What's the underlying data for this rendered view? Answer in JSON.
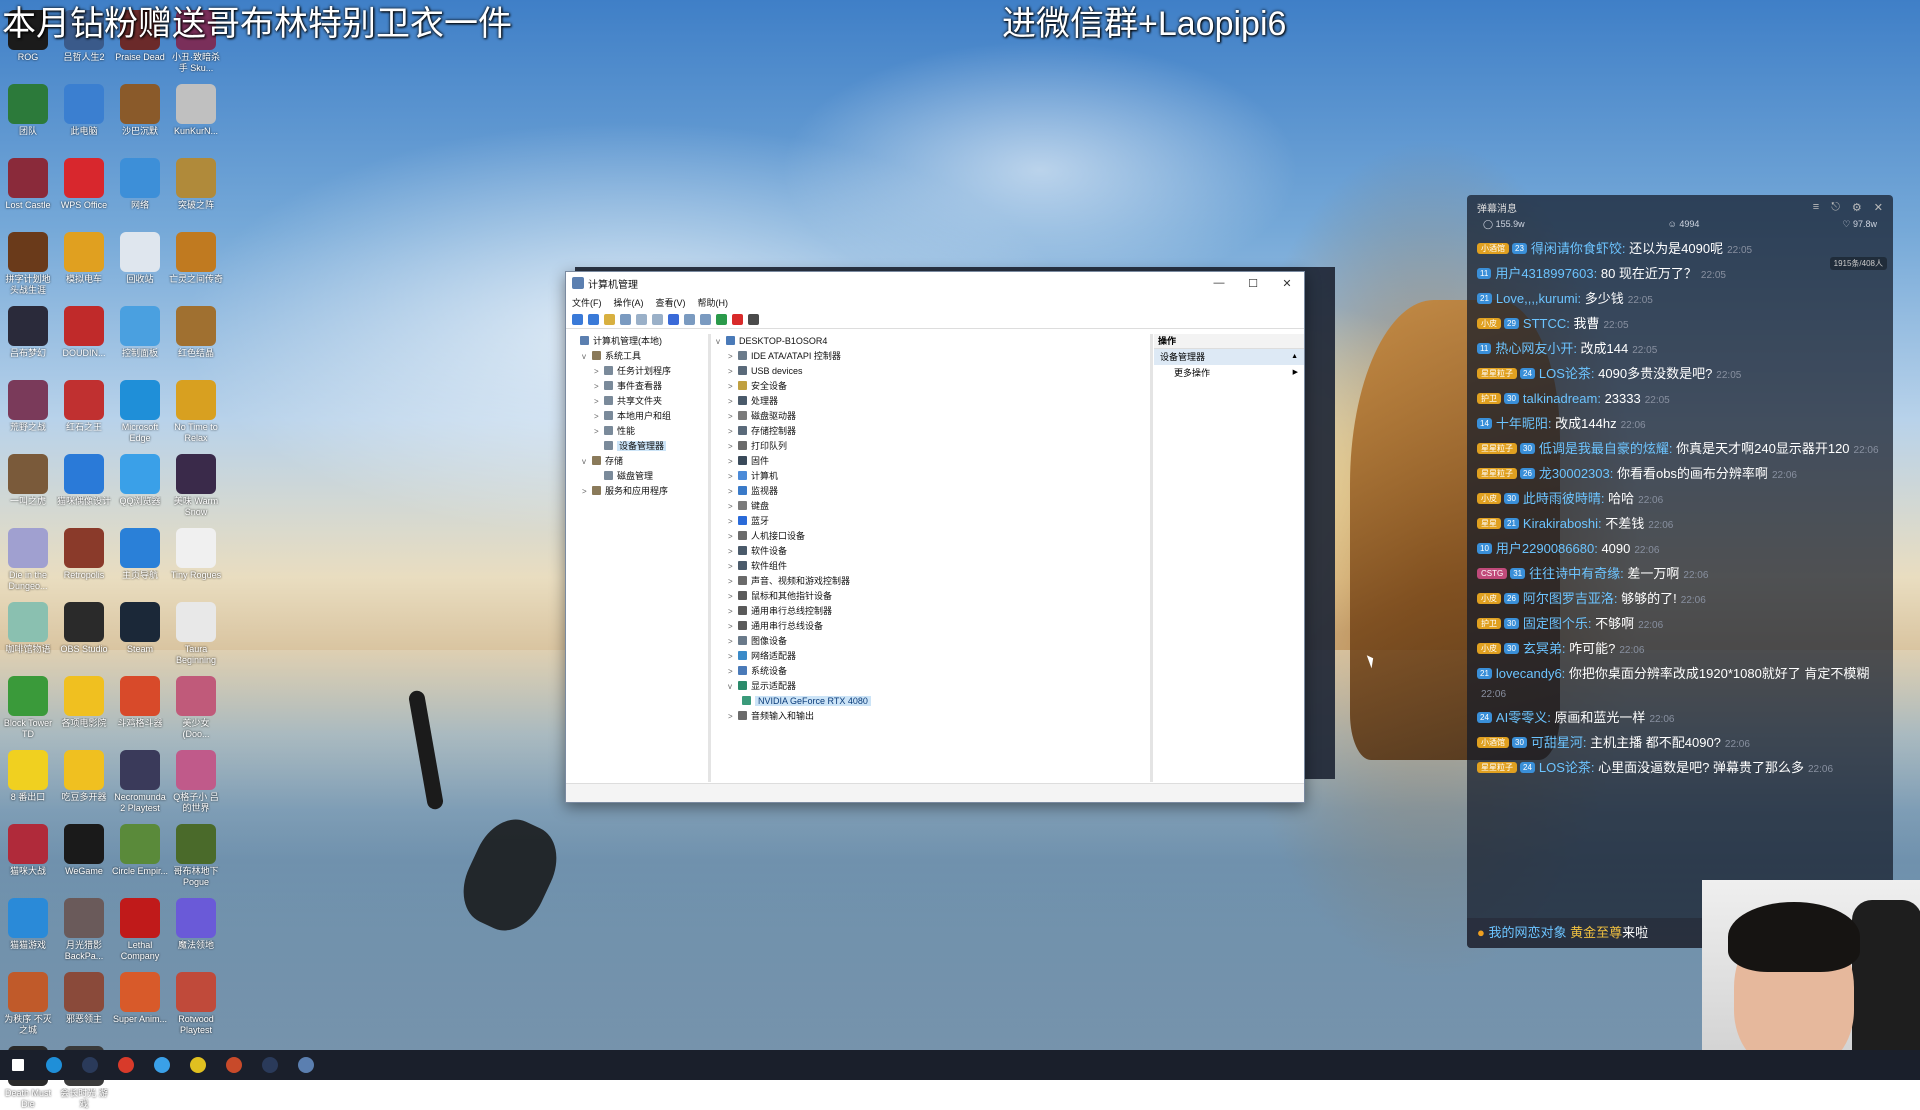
{
  "overlay": {
    "left_text": "本月钻粉赠送哥布林特别卫衣一件",
    "right_text": "进微信群+Laopipi6"
  },
  "desktop_icons": [
    {
      "label": "ROG",
      "color": "#1b1b1b"
    },
    {
      "label": "吕哲人生2",
      "color": "#3a5a8a"
    },
    {
      "label": "Praise Dead",
      "color": "#6b2a2a"
    },
    {
      "label": "小丑·致暗杀手 Sku...",
      "color": "#7a2f5a"
    },
    {
      "label": "团队",
      "color": "#2c7a3a"
    },
    {
      "label": "此电脑",
      "color": "#3b7fd0"
    },
    {
      "label": "沙巴沉默",
      "color": "#8a5a2a"
    },
    {
      "label": "KunKurN...",
      "color": "#c0c0c0"
    },
    {
      "label": "Lost Castle",
      "color": "#8a2a3a"
    },
    {
      "label": "WPS Office",
      "color": "#d8272d"
    },
    {
      "label": "网络",
      "color": "#3d8fd8"
    },
    {
      "label": "突破之阵",
      "color": "#b08a3a"
    },
    {
      "label": "拼字计划地 头战生涯",
      "color": "#6a3a1a"
    },
    {
      "label": "模拟电车",
      "color": "#e0a020"
    },
    {
      "label": "回收站",
      "color": "#dfe6ee"
    },
    {
      "label": "亡灵之间传奇",
      "color": "#c07a20"
    },
    {
      "label": "吕布梦幻",
      "color": "#2a2a3a"
    },
    {
      "label": "DOUDIN...",
      "color": "#c02a2a"
    },
    {
      "label": "控制面板",
      "color": "#4aa0e0"
    },
    {
      "label": "红色结晶",
      "color": "#a07030"
    },
    {
      "label": "荒野之战",
      "color": "#7a3a5a"
    },
    {
      "label": "红石之王",
      "color": "#c03030"
    },
    {
      "label": "Microsoft Edge",
      "color": "#1f8fd8"
    },
    {
      "label": "No Time to Relax",
      "color": "#d8a020"
    },
    {
      "label": "一叫之虎",
      "color": "#7a5a3a"
    },
    {
      "label": "猫咪偶像设计",
      "color": "#2a7ad8"
    },
    {
      "label": "QQ浏览器",
      "color": "#3aa0e8"
    },
    {
      "label": "美味 Warm Snow",
      "color": "#3a2a4a"
    },
    {
      "label": "Die in the Dungeo...",
      "color": "#a0a0d0"
    },
    {
      "label": "Retropolis",
      "color": "#8a3a2a"
    },
    {
      "label": "主页导航",
      "color": "#2a80d8"
    },
    {
      "label": "Tiny Rogues",
      "color": "#f0f0f0"
    },
    {
      "label": "咖啡馆物语",
      "color": "#8ac0b0"
    },
    {
      "label": "OBS Studio",
      "color": "#2a2a2a"
    },
    {
      "label": "Steam",
      "color": "#1b2838"
    },
    {
      "label": "Taura Beginning",
      "color": "#e8e8e8"
    },
    {
      "label": "Block Tower TD",
      "color": "#3a9a3a"
    },
    {
      "label": "各项电影院",
      "color": "#f0c020"
    },
    {
      "label": "斗鸡格斗器",
      "color": "#d84a2a"
    },
    {
      "label": "美少女 (Doo...",
      "color": "#c05a7a"
    },
    {
      "label": "8 番出口",
      "color": "#f0d020"
    },
    {
      "label": "吃豆多开器",
      "color": "#f0c020"
    },
    {
      "label": "Necromunda 2 Playtest",
      "color": "#3a3a5a"
    },
    {
      "label": "Q格子小 吕 的世界",
      "color": "#c05a8a"
    },
    {
      "label": "猫咪大战",
      "color": "#b02a3a"
    },
    {
      "label": "WeGame",
      "color": "#1a1a1a"
    },
    {
      "label": "Circle Empir...",
      "color": "#5a8a3a"
    },
    {
      "label": "哥布林地下 Pogue",
      "color": "#4a6a2a"
    },
    {
      "label": "猫猫游戏",
      "color": "#2a8ad8"
    },
    {
      "label": "月光猎影 BackPa...",
      "color": "#6a5a5a"
    },
    {
      "label": "Lethal Company",
      "color": "#c01a1a"
    },
    {
      "label": "魔法领地",
      "color": "#6a5ad8"
    },
    {
      "label": "为秩序 不灭之城",
      "color": "#c05a2a"
    },
    {
      "label": "邪恶领主",
      "color": "#8a4a3a"
    },
    {
      "label": "Super Anim...",
      "color": "#d85a2a"
    },
    {
      "label": "Rotwood Playtest",
      "color": "#c04a3a"
    },
    {
      "label": "Death Must Die",
      "color": "#2a2a2a"
    },
    {
      "label": "会长时光 游戏",
      "color": "#3a3a3a"
    }
  ],
  "window": {
    "title": "计算机管理",
    "menus": [
      "文件(F)",
      "操作(A)",
      "查看(V)",
      "帮助(H)"
    ],
    "left_tree": [
      {
        "label": "计算机管理(本地)",
        "level": 0,
        "arrow": ""
      },
      {
        "label": "系统工具",
        "level": 1,
        "arrow": "v"
      },
      {
        "label": "任务计划程序",
        "level": 2,
        "arrow": ">"
      },
      {
        "label": "事件查看器",
        "level": 2,
        "arrow": ">"
      },
      {
        "label": "共享文件夹",
        "level": 2,
        "arrow": ">"
      },
      {
        "label": "本地用户和组",
        "level": 2,
        "arrow": ">"
      },
      {
        "label": "性能",
        "level": 2,
        "arrow": ">"
      },
      {
        "label": "设备管理器",
        "level": 2,
        "arrow": "",
        "selected": true
      },
      {
        "label": "存储",
        "level": 1,
        "arrow": "v"
      },
      {
        "label": "磁盘管理",
        "level": 2,
        "arrow": ""
      },
      {
        "label": "服务和应用程序",
        "level": 1,
        "arrow": ">"
      }
    ],
    "device_root": "DESKTOP-B1OSOR4",
    "devices": [
      {
        "label": "IDE ATA/ATAPI 控制器",
        "color": "#6a7a8a"
      },
      {
        "label": "USB devices",
        "color": "#5a6a7a"
      },
      {
        "label": "安全设备",
        "color": "#c0a040"
      },
      {
        "label": "处理器",
        "color": "#4a5a6a"
      },
      {
        "label": "磁盘驱动器",
        "color": "#7a7a7a"
      },
      {
        "label": "存储控制器",
        "color": "#5a6a7a"
      },
      {
        "label": "打印队列",
        "color": "#6a6a6a"
      },
      {
        "label": "固件",
        "color": "#3a4a5a"
      },
      {
        "label": "计算机",
        "color": "#4a8ad8"
      },
      {
        "label": "监视器",
        "color": "#3a7ac8"
      },
      {
        "label": "键盘",
        "color": "#7a7a7a"
      },
      {
        "label": "蓝牙",
        "color": "#2a6ad8"
      },
      {
        "label": "人机接口设备",
        "color": "#6a6a6a"
      },
      {
        "label": "软件设备",
        "color": "#4a5a6a"
      },
      {
        "label": "软件组件",
        "color": "#4a5a6a"
      },
      {
        "label": "声音、视频和游戏控制器",
        "color": "#6a6a6a"
      },
      {
        "label": "鼠标和其他指针设备",
        "color": "#5a5a5a"
      },
      {
        "label": "通用串行总线控制器",
        "color": "#5a5a5a"
      },
      {
        "label": "通用串行总线设备",
        "color": "#5a5a5a"
      },
      {
        "label": "图像设备",
        "color": "#6a7a8a"
      },
      {
        "label": "网络适配器",
        "color": "#3a8ac8"
      },
      {
        "label": "系统设备",
        "color": "#4a7ab8"
      },
      {
        "label": "显示适配器",
        "color": "#2a8a6a",
        "expanded": true
      },
      {
        "label": "NVIDIA GeForce RTX 4080",
        "color": "#3a9a7a",
        "child": true
      },
      {
        "label": "音频输入和输出",
        "color": "#6a6a6a"
      }
    ],
    "actions_header": "操作",
    "actions": [
      {
        "label": "设备管理器",
        "selected": true,
        "arrow": "▲"
      },
      {
        "label": "更多操作",
        "selected": false,
        "arrow": "▶"
      }
    ]
  },
  "chat": {
    "title": "弹幕消息",
    "stats": {
      "hot": "155.9w",
      "online": "4994",
      "likes": "97.8w"
    },
    "rank_badge": "1915条/408人",
    "messages": [
      {
        "badge": "小酒馆",
        "badge_color": "#e0a020",
        "lvl": "23",
        "user": "得闲请你食虾饺:",
        "text": "还以为是4090呢",
        "time": "22:05"
      },
      {
        "badge": "",
        "badge_color": "",
        "lvl": "11",
        "user": "用户4318997603:",
        "text": "80 现在近万了？",
        "time": "22:05"
      },
      {
        "badge": "",
        "badge_color": "",
        "lvl": "21",
        "user": "Love,,,,kurumi:",
        "text": "多少钱",
        "time": "22:05"
      },
      {
        "badge": "小皮",
        "badge_color": "#e0a020",
        "lvl": "29",
        "user": "STTCC:",
        "text": "我曹",
        "time": "22:05"
      },
      {
        "badge": "",
        "badge_color": "",
        "lvl": "11",
        "user": "热心网友小开:",
        "text": "改成144",
        "time": "22:05"
      },
      {
        "badge": "星星粒子",
        "badge_color": "#e0a020",
        "lvl": "24",
        "user": "LOS论茶:",
        "text": "4090多贵没数是吧?",
        "time": "22:05"
      },
      {
        "badge": "护卫",
        "badge_color": "#e0a020",
        "lvl": "30",
        "user": "talkinadream:",
        "text": "23333",
        "time": "22:05"
      },
      {
        "badge": "",
        "badge_color": "",
        "lvl": "14",
        "user": "十年昵阳:",
        "text": "改成144hz",
        "time": "22:06"
      },
      {
        "badge": "星星粒子",
        "badge_color": "#e0a020",
        "lvl": "30",
        "user": "低调是我最自豪的炫耀:",
        "text": "你真是天才啊240显示器开120",
        "time": "22:06"
      },
      {
        "badge": "星星粒子",
        "badge_color": "#e0a020",
        "lvl": "26",
        "user": "龙30002303:",
        "text": "你看看obs的画布分辨率啊",
        "time": "22:06"
      },
      {
        "badge": "小皮",
        "badge_color": "#e0a020",
        "lvl": "30",
        "user": "此時雨彼時晴:",
        "text": "哈哈",
        "time": "22:06"
      },
      {
        "badge": "星星",
        "badge_color": "#e0a020",
        "lvl": "21",
        "user": "Kirakiraboshi:",
        "text": "不差钱",
        "time": "22:06"
      },
      {
        "badge": "",
        "badge_color": "",
        "lvl": "10",
        "user": "用户2290086680:",
        "text": "4090",
        "time": "22:06"
      },
      {
        "badge": "CSTG",
        "badge_color": "#c04a7a",
        "lvl": "31",
        "user": "往往诗中有奇缘:",
        "text": "差一万啊",
        "time": "22:06"
      },
      {
        "badge": "小皮",
        "badge_color": "#e0a020",
        "lvl": "26",
        "user": "阿尔图罗吉亚洛:",
        "text": "够够的了!",
        "time": "22:06"
      },
      {
        "badge": "护卫",
        "badge_color": "#e0a020",
        "lvl": "30",
        "user": "固定图个乐:",
        "text": "不够啊",
        "time": "22:06"
      },
      {
        "badge": "小皮",
        "badge_color": "#e0a020",
        "lvl": "30",
        "user": "玄冥弟:",
        "text": "咋可能?",
        "time": "22:06"
      },
      {
        "badge": "",
        "badge_color": "",
        "lvl": "21",
        "user": "lovecandy6:",
        "text": "你把你桌面分辨率改成1920*1080就好了 肯定不模糊",
        "time": "22:06"
      },
      {
        "badge": "",
        "badge_color": "",
        "lvl": "24",
        "user": "AI零零义:",
        "text": "原画和蓝光一样",
        "time": "22:06"
      },
      {
        "badge": "小酒馆",
        "badge_color": "#e0a020",
        "lvl": "30",
        "user": "可甜星河:",
        "text": "主机主播 都不配4090?",
        "time": "22:06"
      },
      {
        "badge": "星星粒子",
        "badge_color": "#e0a020",
        "lvl": "24",
        "user": "LOS论茶:",
        "text": "心里面没逼数是吧? 弹幕贵了那么多",
        "time": "22:06"
      }
    ],
    "footer": {
      "user": "我的网恋对象",
      "highlight": "黄金至尊",
      "text": "来啦"
    }
  },
  "taskbar": [
    {
      "name": "start",
      "color": "#ffffff"
    },
    {
      "name": "edge",
      "color": "#1f8fd8"
    },
    {
      "name": "steam",
      "color": "#2a3a5a"
    },
    {
      "name": "chrome",
      "color": "#d83a2a"
    },
    {
      "name": "qq-browser",
      "color": "#3aa0e8"
    },
    {
      "name": "app-yellow",
      "color": "#e0c020"
    },
    {
      "name": "app-red",
      "color": "#c84a2a"
    },
    {
      "name": "steam-2",
      "color": "#2a3a5a"
    },
    {
      "name": "computer-management",
      "color": "#5b7fb0"
    }
  ]
}
